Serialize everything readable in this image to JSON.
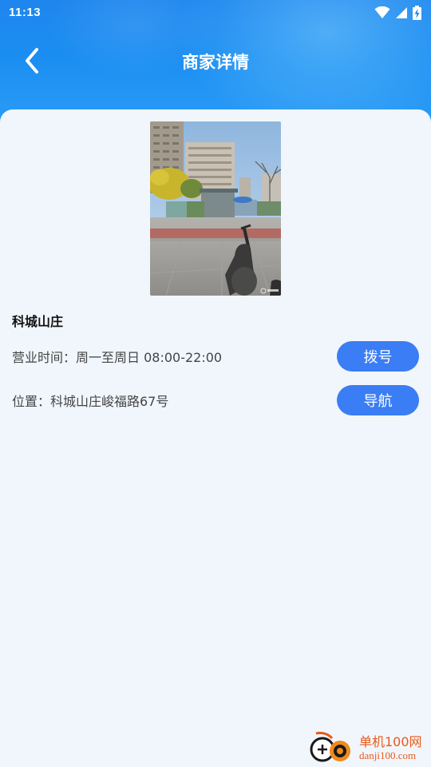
{
  "status_bar": {
    "time": "11:13",
    "icons": [
      "wifi-icon",
      "signal-icon",
      "battery-charging-icon"
    ]
  },
  "header": {
    "back_icon": "chevron-left-icon",
    "title": "商家详情"
  },
  "store": {
    "photo": "store-entrance-photo",
    "name": "科城山庄",
    "hours_text": "营业时间：周一至周日 08:00-22:00",
    "location_text": "位置：科城山庄峻福路67号",
    "call_label": "拨号",
    "navigate_label": "导航"
  },
  "watermark": {
    "cn": "单机100网",
    "en": "danji100.com"
  },
  "colors": {
    "header_blue": "#1e86ee",
    "button_blue": "#3a7df4",
    "page_bg": "#f1f6fd",
    "watermark_orange": "#e85a1a"
  }
}
